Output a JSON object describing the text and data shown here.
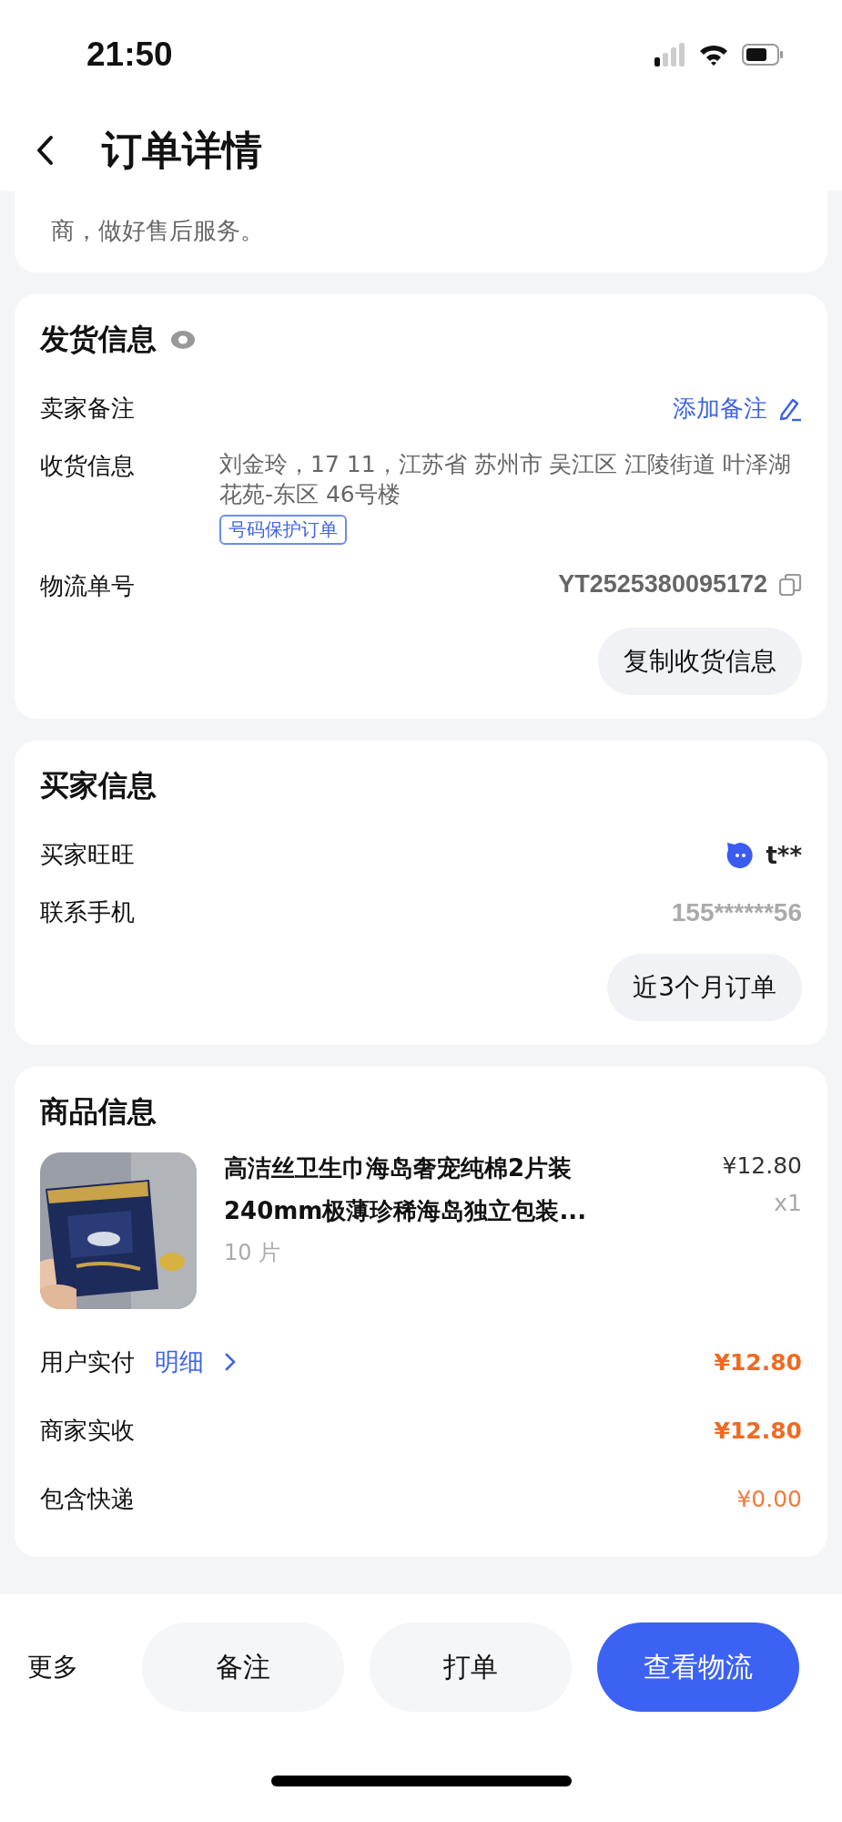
{
  "status_bar": {
    "time": "21:50"
  },
  "header": {
    "title": "订单详情"
  },
  "notice": {
    "text": "商，做好售后服务。"
  },
  "shipping": {
    "title": "发货信息",
    "rows": [
      {
        "kind": "action",
        "label": "卖家备注",
        "value": "添加备注"
      },
      {
        "kind": "address",
        "label": "收货信息",
        "value": "刘金玲，17  11，江苏省 苏州市 吴江区 江陵街道 叶泽湖花苑-东区 46号楼",
        "tag": "号码保护订单"
      },
      {
        "kind": "copy",
        "label": "物流单号",
        "value": "YT2525380095172"
      }
    ],
    "button": "复制收货信息"
  },
  "buyer": {
    "title": "买家信息",
    "rows": [
      {
        "kind": "wangwang",
        "label": "买家旺旺",
        "value": "t**"
      },
      {
        "kind": "muted",
        "label": "联系手机",
        "value": "155******56"
      }
    ],
    "button": "近3个月订单"
  },
  "goods": {
    "title": "商品信息",
    "item": {
      "image": {
        "kind": "picture"
      },
      "name_lines": [
        "高洁丝卫生巾海岛奢宠纯棉2片装",
        "240mm极薄珍稀海岛独立包装..."
      ],
      "spec": "10 片",
      "price": "¥12.80",
      "quantity": "x1"
    },
    "payments": [
      {
        "label": "用户实付",
        "link": "明细",
        "amount": "¥12.80",
        "emphasis": true
      },
      {
        "label": "商家实收",
        "amount": "¥12.80",
        "emphasis": true
      },
      {
        "label": "包含快递",
        "amount": "¥0.00",
        "emphasis": false
      }
    ]
  },
  "bottom_bar": {
    "more": "更多",
    "buttons": [
      {
        "label": "备注",
        "primary": false
      },
      {
        "label": "打单",
        "primary": false
      },
      {
        "label": "查看物流",
        "primary": true
      }
    ]
  }
}
